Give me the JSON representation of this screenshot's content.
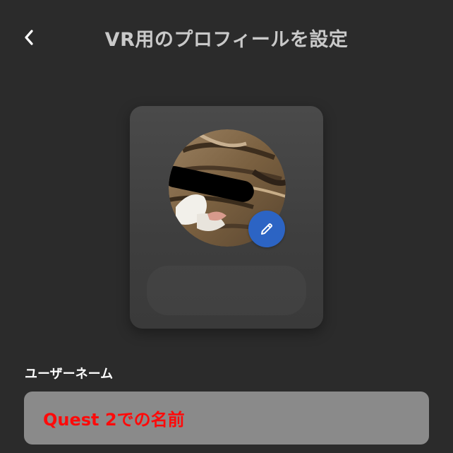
{
  "header": {
    "title": "VR用のプロフィールを設定",
    "back_icon": "chevron-left-icon"
  },
  "profile_card": {
    "avatar": "cat-photo-avatar",
    "edit_icon": "pencil-icon",
    "colors": {
      "edit_button": "#2c64c4",
      "card": "#444444"
    }
  },
  "username": {
    "label": "ユーザーネーム",
    "value": "Quest 2での名前"
  },
  "colors": {
    "background": "#2b2b2b",
    "field": "#8a8a8a",
    "value_text": "#ff0a0a"
  }
}
